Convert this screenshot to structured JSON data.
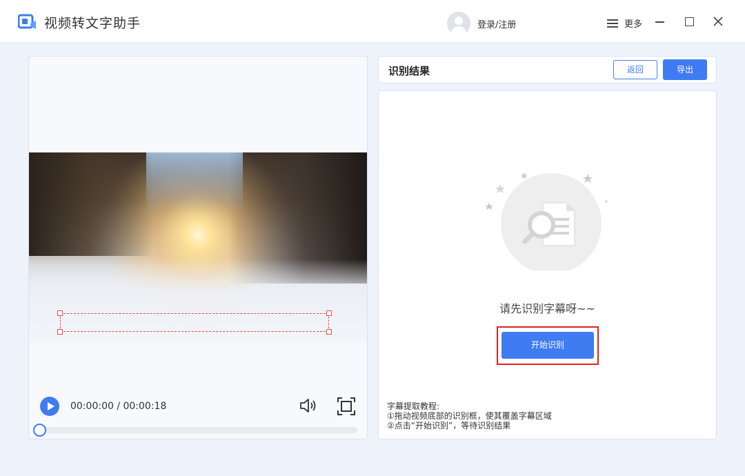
{
  "app": {
    "title": "视频转文字助手",
    "login_label": "登录/注册",
    "more_label": "更多"
  },
  "player": {
    "time": "00:00:00 / 00:00:18",
    "progress": 0
  },
  "result": {
    "title": "识别结果",
    "back_label": "返回",
    "export_label": "导出",
    "empty_text": "请先识别字幕呀~~",
    "start_label": "开始识别",
    "tutorial": {
      "heading": "字幕提取教程:",
      "step1": "①拖动视频底部的识别框，使其覆盖字幕区域",
      "step2": "②点击“开始识别”，等待识别结果"
    }
  },
  "colors": {
    "accent": "#3f7cf2",
    "highlight": "#e02020",
    "selection": "#e8484a"
  }
}
